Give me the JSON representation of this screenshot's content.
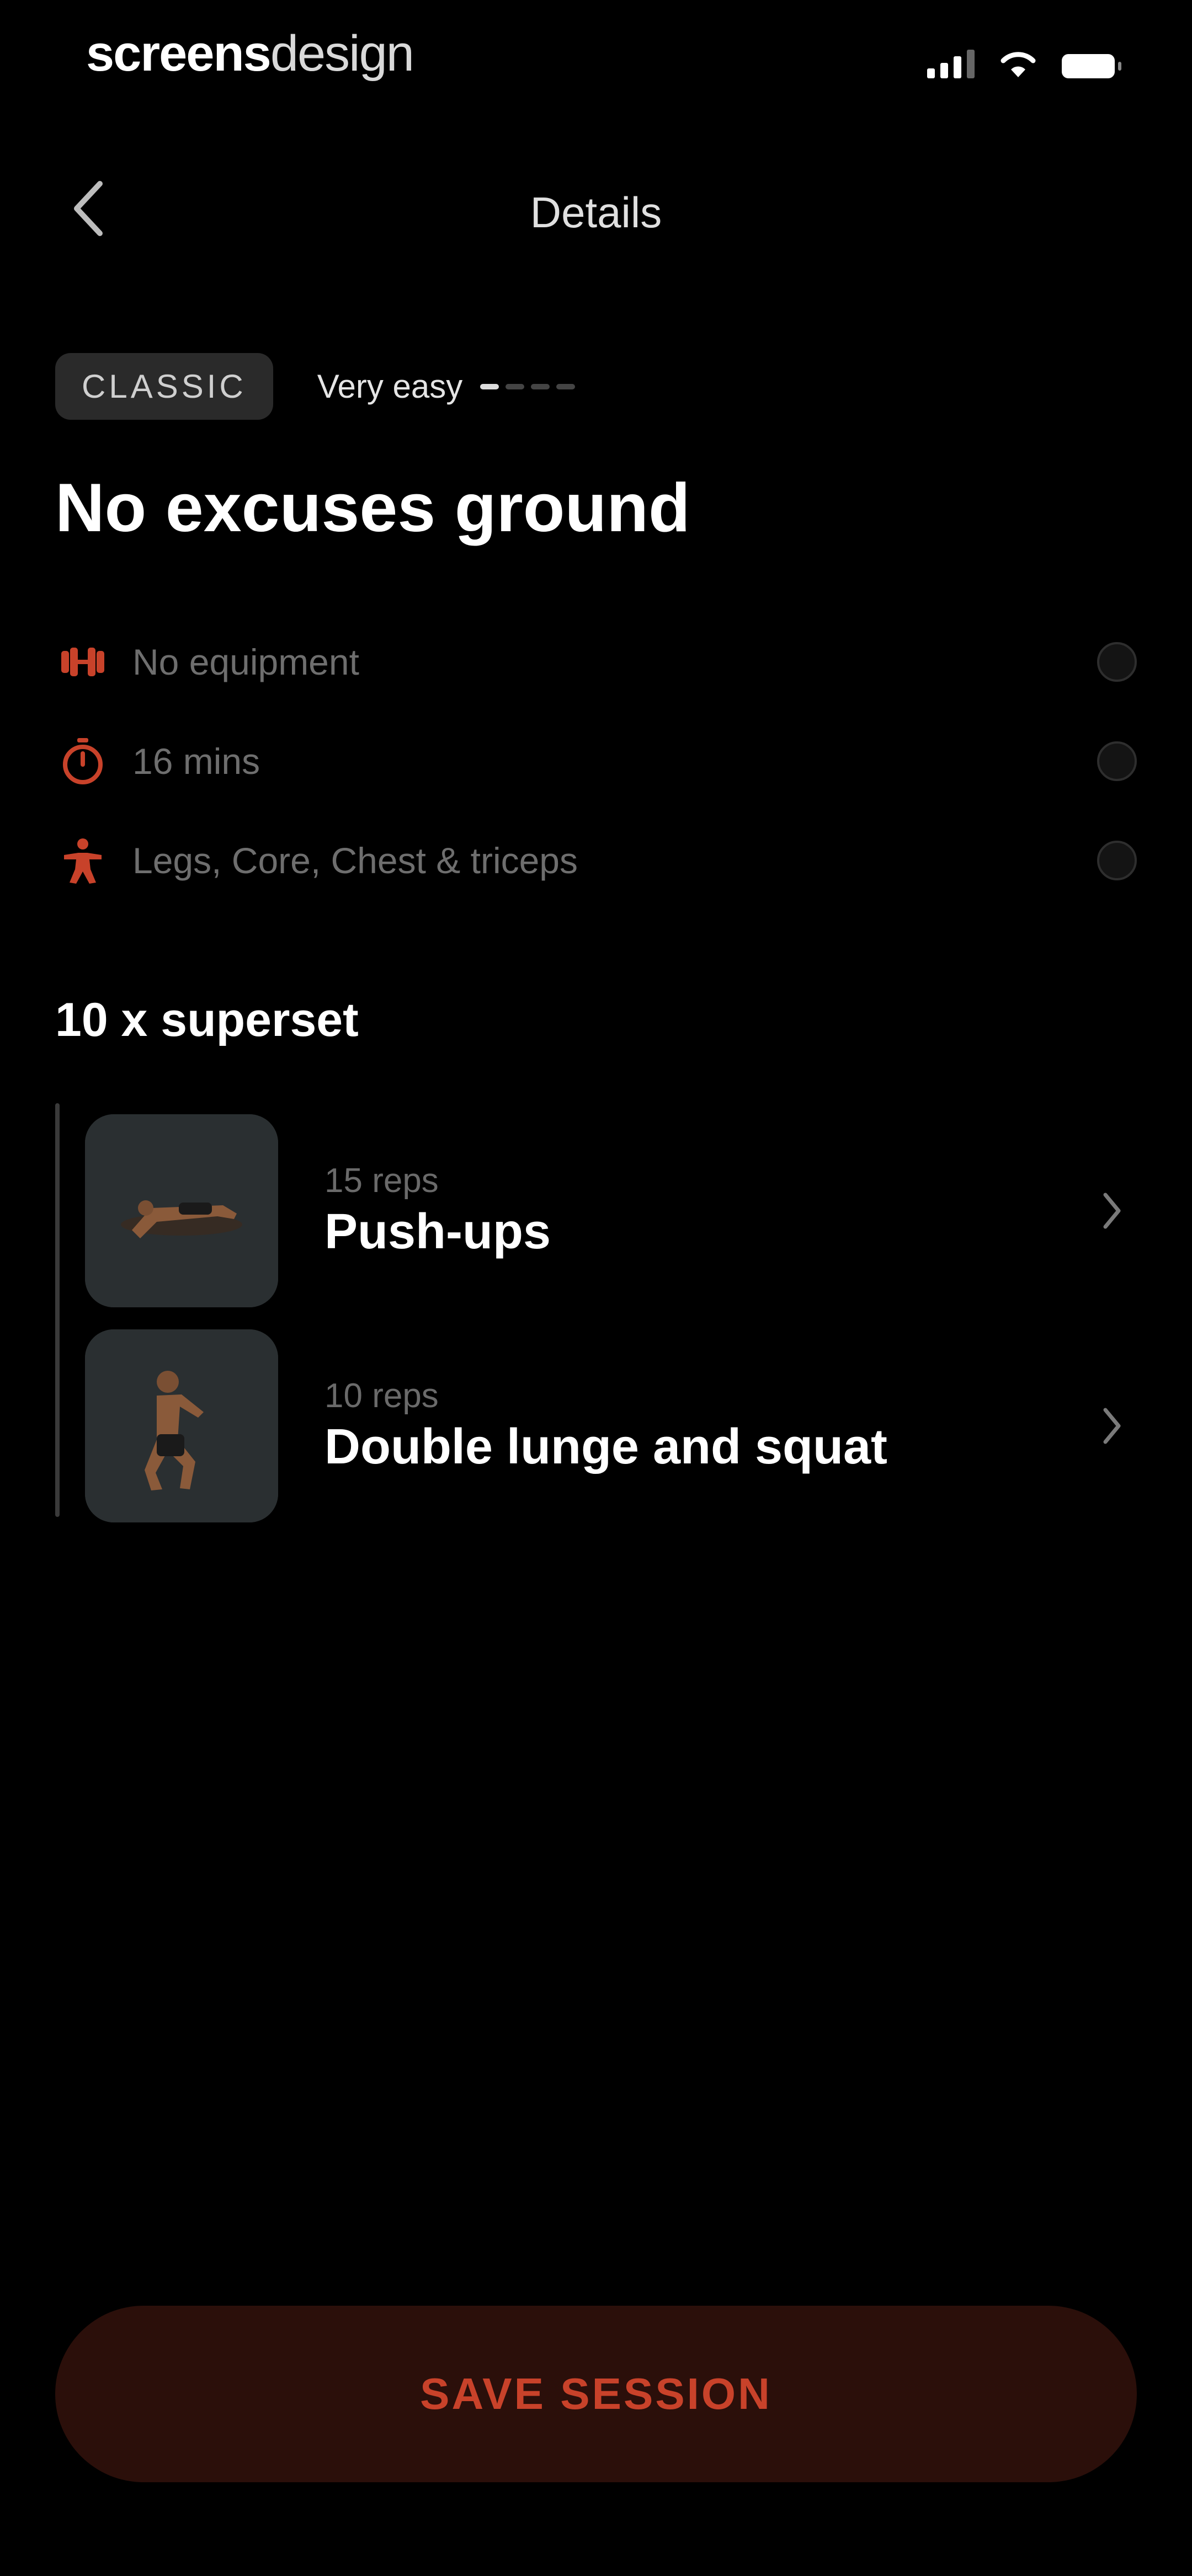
{
  "status_bar": {
    "brand_bold": "screens",
    "brand_light": "design"
  },
  "nav": {
    "title": "Details",
    "back_icon": "chevron-left-icon"
  },
  "tags": {
    "badge": "CLASSIC",
    "difficulty": "Very easy",
    "difficulty_level": 1,
    "difficulty_max": 4
  },
  "workout": {
    "title": "No excuses ground"
  },
  "info": [
    {
      "icon": "dumbbell-icon",
      "label": "No equipment"
    },
    {
      "icon": "timer-icon",
      "label": "16 mins"
    },
    {
      "icon": "body-icon",
      "label": "Legs, Core, Chest & triceps"
    }
  ],
  "superset": {
    "title": "10 x superset",
    "exercises": [
      {
        "reps": "15 reps",
        "name": "Push-ups"
      },
      {
        "reps": "10 reps",
        "name": "Double lunge and squat"
      }
    ]
  },
  "footer": {
    "save_label": "SAVE SESSION"
  },
  "colors": {
    "accent": "#c8422a",
    "button_bg": "#2b0f0a",
    "background": "#000000"
  }
}
